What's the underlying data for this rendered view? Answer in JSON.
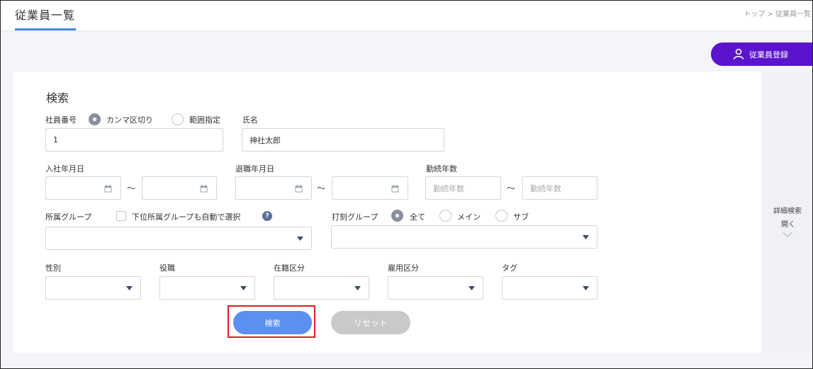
{
  "header": {
    "title": "従業員一覧",
    "breadcrumb": "トップ > 従業員一覧"
  },
  "actions": {
    "register_label": "従業員登録"
  },
  "search": {
    "title": "検索",
    "employee_no": {
      "label": "社員番号",
      "option_comma": "カンマ区切り",
      "option_range": "範囲指定",
      "selected": "カンマ区切り",
      "value": "1"
    },
    "name": {
      "label": "氏名",
      "value": "神社太郎"
    },
    "join_date": {
      "label": "入社年月日",
      "from": "",
      "to": ""
    },
    "leave_date": {
      "label": "退職年月日",
      "from": "",
      "to": ""
    },
    "years": {
      "label": "勤続年数",
      "from_placeholder": "勤続年数",
      "to_placeholder": "勤続年数"
    },
    "range_sep": "～",
    "group": {
      "label": "所属グループ",
      "sub_checkbox_label": "下位所属グループも自動で選択",
      "sub_checked": false,
      "help": "?",
      "value": ""
    },
    "punch_group": {
      "label": "打刻グループ",
      "option_all": "全て",
      "option_main": "メイン",
      "option_sub": "サブ",
      "selected": "全て",
      "value": ""
    },
    "gender": {
      "label": "性別",
      "value": ""
    },
    "position": {
      "label": "役職",
      "value": ""
    },
    "enroll_status": {
      "label": "在籍区分",
      "value": ""
    },
    "employment_type": {
      "label": "雇用区分",
      "value": ""
    },
    "tag": {
      "label": "タグ",
      "value": ""
    },
    "search_button": "検索",
    "reset_button": "リセット"
  },
  "side": {
    "detail_label": "詳細検索",
    "open_label": "開く"
  },
  "colors": {
    "accent": "#5b14cc",
    "primary_button": "#5b8ff0",
    "reset_button": "#c9c9cc",
    "highlight": "#d42020",
    "tab_underline": "#4a86e8"
  }
}
